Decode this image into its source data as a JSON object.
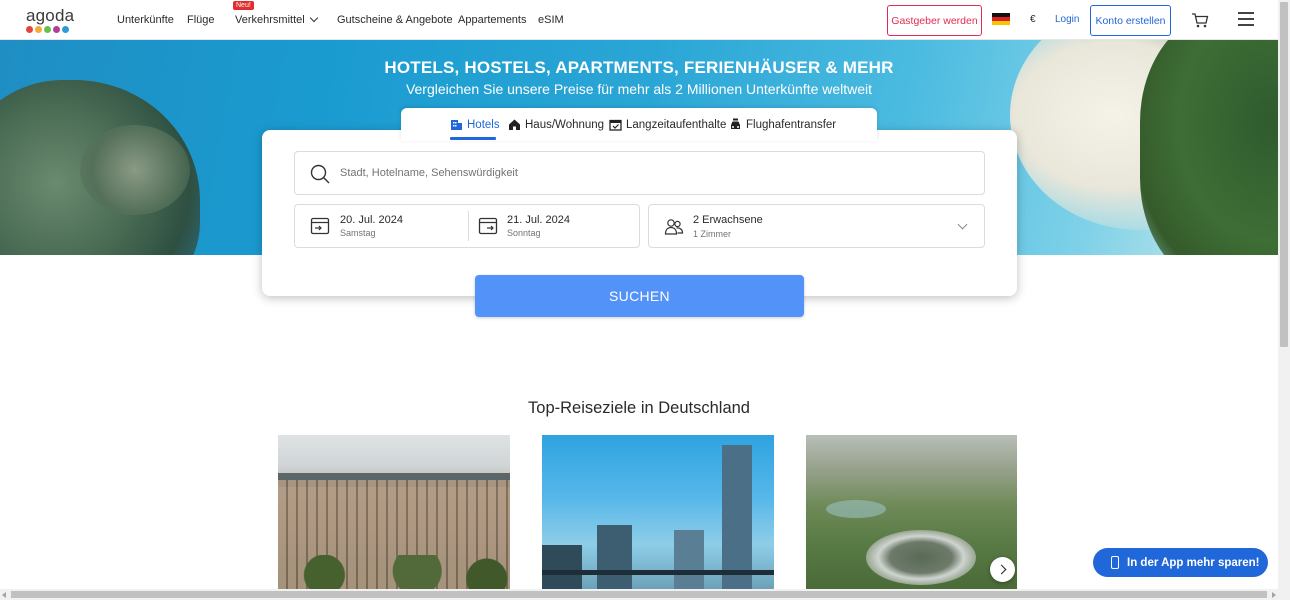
{
  "brand": {
    "logo_text": "agoda",
    "dot_colors": [
      "#e2453b",
      "#f8a936",
      "#6bc04b",
      "#b33d9a",
      "#2c9bd6"
    ]
  },
  "nav": {
    "items": [
      "Unterkünfte",
      "Flüge",
      "Verkehrsmittel",
      "Gutscheine & Angebote",
      "Appartements",
      "eSIM"
    ],
    "new_badge": "Neu!",
    "host_button": "Gastgeber werden",
    "currency": "€",
    "login": "Login",
    "create_account": "Konto erstellen"
  },
  "hero": {
    "title": "HOTELS, HOSTELS, APARTMENTS, FERIENHÄUSER & MEHR",
    "subtitle": "Vergleichen Sie unsere Preise für mehr als 2 Millionen Unterkünfte weltweit"
  },
  "search": {
    "tabs": [
      "Hotels",
      "Haus/Wohnung",
      "Langzeitaufenthalte",
      "Flughafentransfer"
    ],
    "active_tab": "Hotels",
    "placeholder": "Stadt, Hotelname, Sehenswürdigkeit",
    "checkin": {
      "date": "20. Jul. 2024",
      "day": "Samstag"
    },
    "checkout": {
      "date": "21. Jul. 2024",
      "day": "Sonntag"
    },
    "guests": {
      "main": "2 Erwachsene",
      "sub": "1 Zimmer"
    },
    "button": "SUCHEN"
  },
  "destinations": {
    "title": "Top-Reiseziele in Deutschland"
  },
  "app_promo": {
    "label": "In der App mehr sparen!"
  },
  "colors": {
    "accent_blue": "#2067da",
    "search_button": "#5392f9",
    "host_red": "#e12d50"
  }
}
